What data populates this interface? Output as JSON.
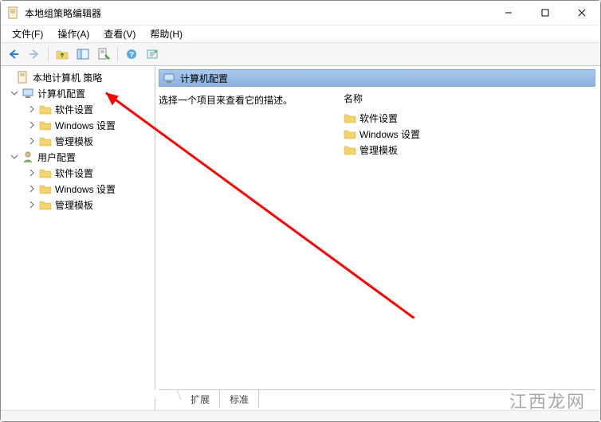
{
  "window": {
    "title": "本地组策略编辑器"
  },
  "menu": {
    "file": "文件(F)",
    "action": "操作(A)",
    "view": "查看(V)",
    "help": "帮助(H)"
  },
  "tree": {
    "root": "本地计算机 策略",
    "computer": "计算机配置",
    "user": "用户配置",
    "sw": "软件设置",
    "win": "Windows 设置",
    "adm": "管理模板"
  },
  "main": {
    "header": "计算机配置",
    "desc": "选择一个项目来查看它的描述。",
    "list_header": "名称",
    "items": {
      "sw": "软件设置",
      "win": "Windows 设置",
      "adm": "管理模板"
    }
  },
  "tabs": {
    "extended": "扩展",
    "standard": "标准"
  },
  "watermark": "江西龙网"
}
